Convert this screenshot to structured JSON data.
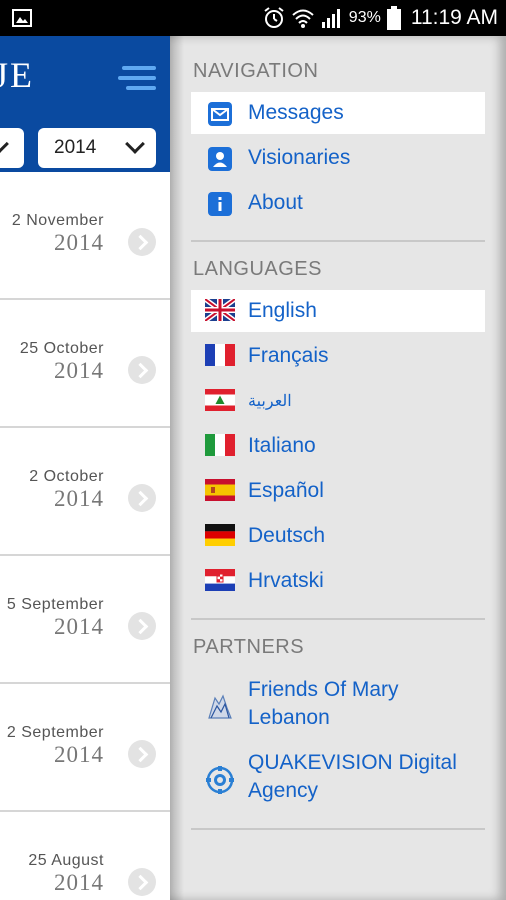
{
  "status_bar": {
    "battery_pct": "93%",
    "time": "11:19 AM",
    "icons": [
      "image-icon",
      "alarm-icon",
      "wifi-icon",
      "signal-icon",
      "battery-icon"
    ]
  },
  "app": {
    "logo_text": "JE",
    "filters": {
      "month_value": "",
      "year_value": "2014"
    },
    "list": [
      {
        "day": "2 November",
        "year": "2014"
      },
      {
        "day": "25 October",
        "year": "2014"
      },
      {
        "day": "2 October",
        "year": "2014"
      },
      {
        "day": "5 September",
        "year": "2014"
      },
      {
        "day": "2 September",
        "year": "2014"
      },
      {
        "day": "25 August",
        "year": "2014"
      }
    ]
  },
  "drawer": {
    "navigation": {
      "title": "NAVIGATION",
      "items": [
        {
          "label": "Messages",
          "icon": "envelope-icon"
        },
        {
          "label": "Visionaries",
          "icon": "person-icon"
        },
        {
          "label": "About",
          "icon": "info-icon"
        }
      ]
    },
    "languages": {
      "title": "LANGUAGES",
      "items": [
        {
          "label": "English",
          "flag": "uk-flag-icon"
        },
        {
          "label": "Français",
          "flag": "france-flag-icon"
        },
        {
          "label": "العربية",
          "flag": "lebanon-flag-icon"
        },
        {
          "label": "Italiano",
          "flag": "italy-flag-icon"
        },
        {
          "label": "Español",
          "flag": "spain-flag-icon"
        },
        {
          "label": "Deutsch",
          "flag": "germany-flag-icon"
        },
        {
          "label": "Hrvatski",
          "flag": "croatia-flag-icon"
        }
      ]
    },
    "partners": {
      "title": "PARTNERS",
      "items": [
        {
          "label": "Friends Of Mary Lebanon",
          "icon": "friends-of-mary-logo-icon"
        },
        {
          "label": "QUAKEVISION Digital Agency",
          "icon": "quakevision-logo-icon"
        }
      ]
    }
  },
  "colors": {
    "brand_blue": "#0a4aa0",
    "link_blue": "#1462c8",
    "drawer_bg": "#e6e6e6"
  }
}
